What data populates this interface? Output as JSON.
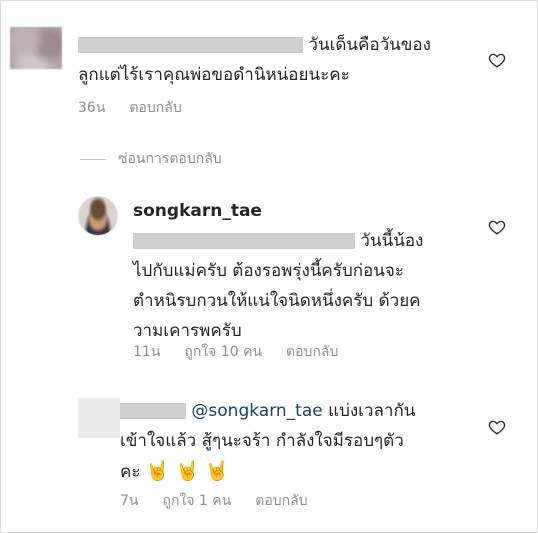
{
  "comment1": {
    "text_line1": "วันเด็นคือวันของ",
    "text_line2": "ลูกแต่ไร้เราคุณพ่อขอดำนิหน่อยนะคะ",
    "time": "36น",
    "reply_label": "ตอบกลับ"
  },
  "hide_replies_label": "ซ่อนการตอบกลับ",
  "reply1": {
    "username": "songkarn_tae",
    "text_line1_end": "วันนี้น้อง",
    "text_line2": "ไปกับแม่ครับ ต้องรอพรุ่งนี้ครับก่อนจะ",
    "text_line3": "ตำหนิรบกวนให้แน่ใจนิดหนึ่งครับ ด้วยค",
    "text_line4": "วามเคารพครับ",
    "time": "11น",
    "likes": "ถูกใจ 10 คน",
    "reply_label": "ตอบกลับ"
  },
  "reply2": {
    "mention": "@songkarn_tae",
    "text_line1_end": "แบ่งเวลากัน",
    "text_line2": "เข้าใจแล้ว สู้ๆนะจร้า กำลังใจมีรอบๆตัว",
    "text_line3": "คะ",
    "emojis": [
      "🤘",
      "🤘",
      "🤘"
    ],
    "time": "7น",
    "likes": "ถูกใจ 1 คน",
    "reply_label": "ตอบกลับ"
  },
  "icons": {
    "like": "heart-icon",
    "emoji": "rock-on-emoji"
  }
}
